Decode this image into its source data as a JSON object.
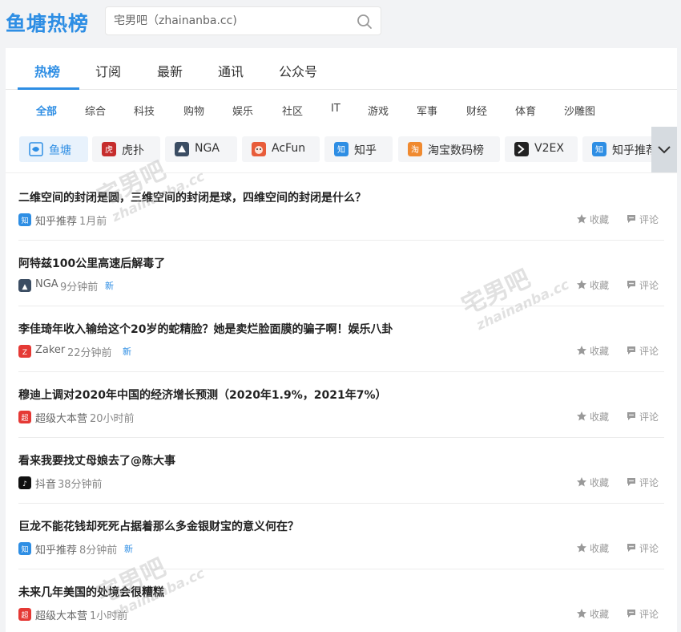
{
  "header": {
    "logo": "鱼塘热榜",
    "search_placeholder": "宅男吧（zhainanba.cc)"
  },
  "tabs": [
    {
      "label": "热榜",
      "active": true
    },
    {
      "label": "订阅"
    },
    {
      "label": "最新"
    },
    {
      "label": "通讯"
    },
    {
      "label": "公众号"
    }
  ],
  "categories": [
    "全部",
    "综合",
    "科技",
    "购物",
    "娱乐",
    "社区",
    "IT",
    "游戏",
    "军事",
    "财经",
    "体育",
    "沙雕图"
  ],
  "sources": [
    {
      "label": "鱼塘",
      "icon": "fishpond-icon",
      "color": "#2e8ee4",
      "active": true
    },
    {
      "label": "虎扑",
      "icon": "hupu-icon",
      "color": "#c62d2d"
    },
    {
      "label": "NGA",
      "icon": "nga-icon",
      "color": "#3b4d63"
    },
    {
      "label": "AcFun",
      "icon": "acfun-icon",
      "color": "#e85c3a"
    },
    {
      "label": "知乎",
      "icon": "zhihu-icon",
      "color": "#2e8ee4"
    },
    {
      "label": "淘宝数码榜",
      "icon": "taobao-icon",
      "color": "#f08a30"
    },
    {
      "label": "V2EX",
      "icon": "v2ex-icon",
      "color": "#222222"
    },
    {
      "label": "知乎推荐",
      "icon": "zhihu-rec-icon",
      "color": "#2e8ee4"
    }
  ],
  "action_labels": {
    "favorite": "收藏",
    "comment": "评论"
  },
  "items": [
    {
      "title": "二维空间的封闭是圆，三维空间的封闭是球，四维空间的封闭是什么？",
      "source": "知乎推荐",
      "source_icon": "zhihu-rec-icon",
      "source_color": "#2e8ee4",
      "time": "1月前",
      "new": ""
    },
    {
      "title": "阿特兹100公里高速后解毒了",
      "source": "NGA",
      "source_icon": "nga-icon",
      "source_color": "#3b4d63",
      "time": "9分钟前",
      "new": "新"
    },
    {
      "title": "李佳琦年收入输给这个20岁的蛇精脸？她是卖烂脸面膜的骗子啊！娱乐八卦",
      "source": "Zaker",
      "source_icon": "zaker-icon",
      "source_color": "#e53935",
      "time": "22分钟前",
      "new": "新"
    },
    {
      "title": "穆迪上调对2020年中国的经济增长预测（2020年1.9%，2021年7%）",
      "source": "超级大本营",
      "source_icon": "chaoji-icon",
      "source_color": "#e53935",
      "time": "20小时前",
      "new": ""
    },
    {
      "title": "看来我要找丈母娘去了@陈大事",
      "source": "抖音",
      "source_icon": "douyin-icon",
      "source_color": "#111111",
      "time": "38分钟前",
      "new": ""
    },
    {
      "title": "巨龙不能花钱却死死占据着那么多金银财宝的意义何在？",
      "source": "知乎推荐",
      "source_icon": "zhihu-rec-icon",
      "source_color": "#2e8ee4",
      "time": "8分钟前",
      "new": "新"
    },
    {
      "title": "未来几年美国的处境会很糟糕",
      "source": "超级大本营",
      "source_icon": "chaoji-icon",
      "source_color": "#e53935",
      "time": "1小时前",
      "new": ""
    }
  ],
  "watermark": {
    "big": "宅男吧",
    "small": "zhainanba.cc"
  }
}
